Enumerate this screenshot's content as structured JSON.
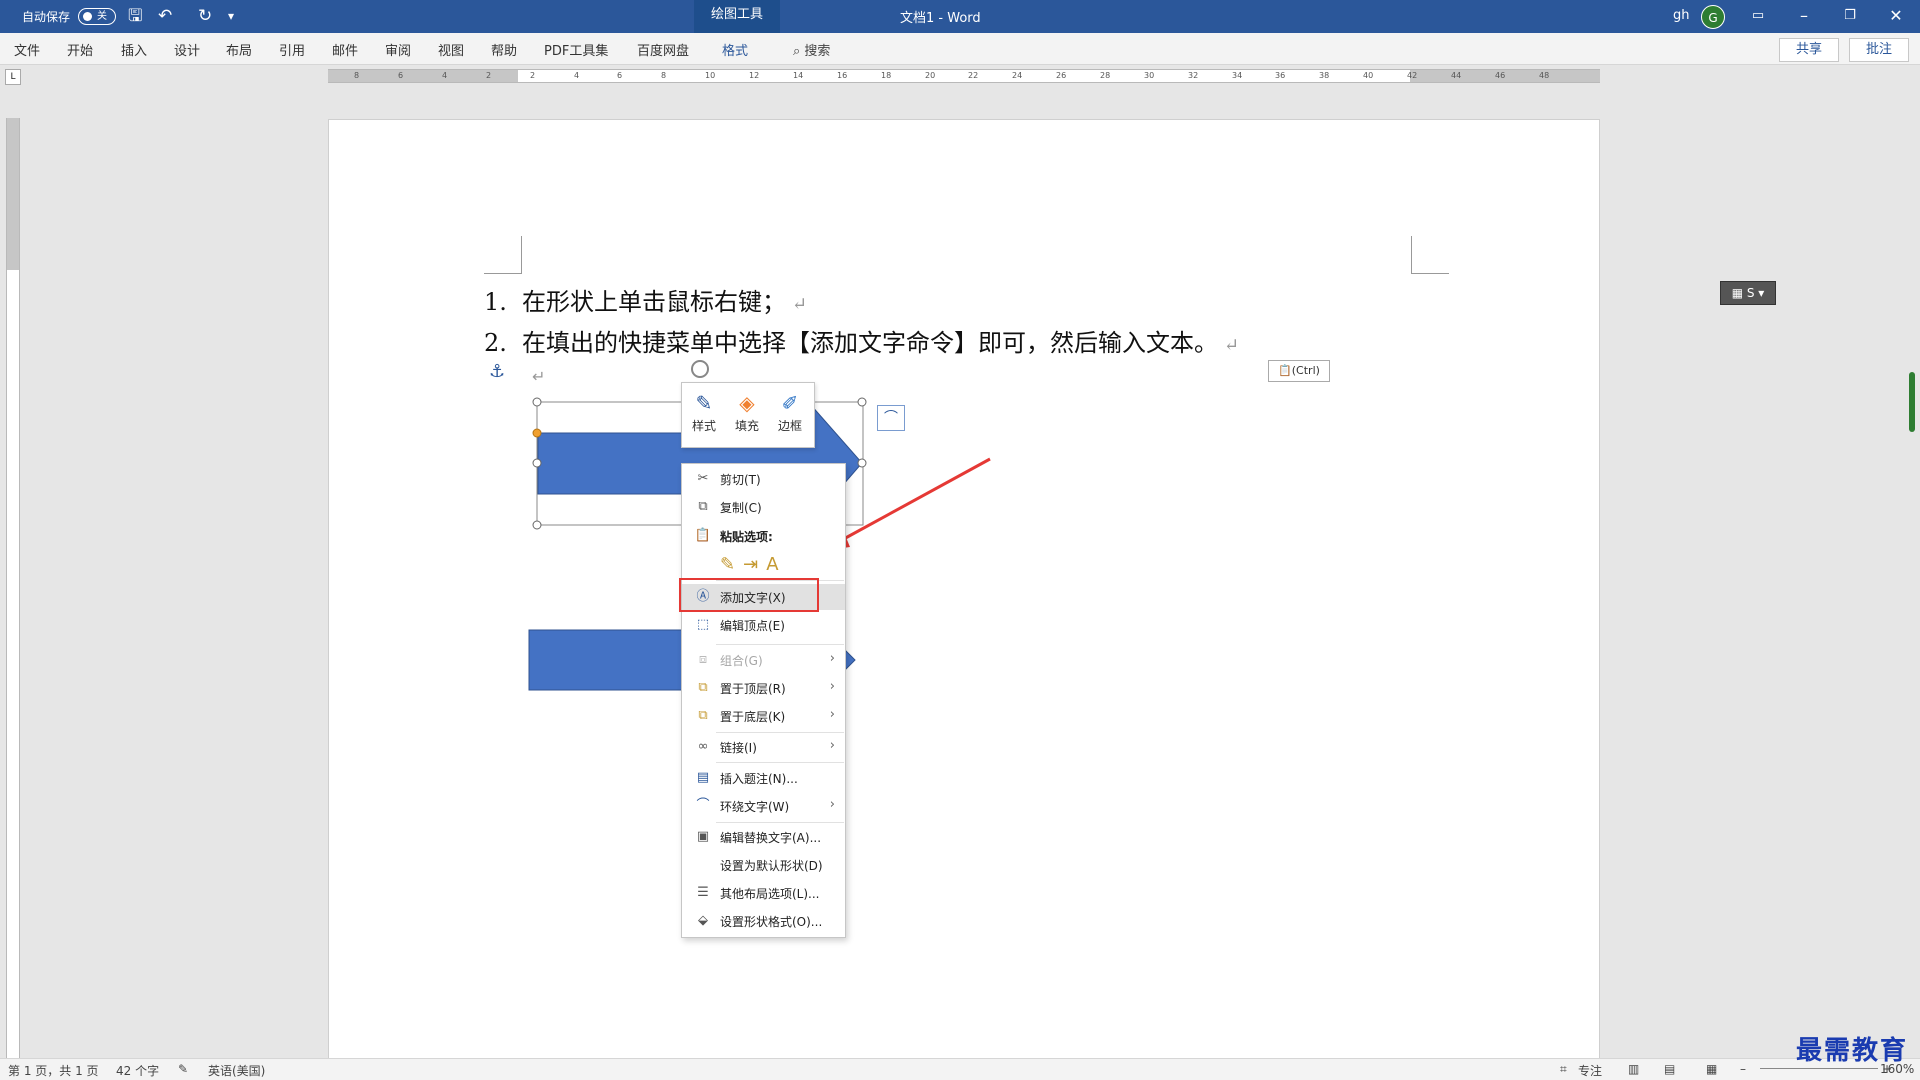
{
  "titlebar": {
    "autosave_label": "自动保存",
    "autosave_state": "关",
    "context_tab": "绘图工具",
    "doc_title": "文档1  -  Word",
    "user": "gh",
    "avatar_initial": "G"
  },
  "ribbon": {
    "tabs": [
      "文件",
      "开始",
      "插入",
      "设计",
      "布局",
      "引用",
      "邮件",
      "审阅",
      "视图",
      "帮助",
      "PDF工具集",
      "百度网盘",
      "格式"
    ],
    "search": "搜索",
    "share": "共享",
    "comment": "批注"
  },
  "ruler": {
    "ticks": [
      "8",
      "6",
      "4",
      "2",
      "2",
      "4",
      "6",
      "8",
      "10",
      "12",
      "14",
      "16",
      "18",
      "20",
      "22",
      "24",
      "26",
      "28",
      "30",
      "32",
      "34",
      "36",
      "38",
      "40",
      "42",
      "44",
      "46",
      "48"
    ]
  },
  "document": {
    "items": [
      {
        "num": "1.",
        "text": "在形状上单击鼠标右键；"
      },
      {
        "num": "2.",
        "text": "在填出的快捷菜单中选择【添加文字命令】即可，然后输入文本。"
      }
    ],
    "paste_ctrl": "(Ctrl)"
  },
  "mini_toolbar": [
    {
      "label": "样式",
      "icon": "shape-style-icon"
    },
    {
      "label": "填充",
      "icon": "fill-bucket-icon"
    },
    {
      "label": "边框",
      "icon": "outline-pen-icon"
    }
  ],
  "context_menu": {
    "cut": "剪切(T)",
    "copy": "复制(C)",
    "paste_options": "粘贴选项:",
    "add_text": "添加文字(X)",
    "edit_points": "编辑顶点(E)",
    "group": "组合(G)",
    "bring_front": "置于顶层(R)",
    "send_back": "置于底层(K)",
    "link": "链接(I)",
    "insert_caption": "插入题注(N)...",
    "wrap_text": "环绕文字(W)",
    "edit_alt_text": "编辑替换文字(A)...",
    "set_default": "设置为默认形状(D)",
    "more_layout": "其他布局选项(L)...",
    "format_shape": "设置形状格式(O)..."
  },
  "statusbar": {
    "page": "第 1 页，共 1 页",
    "words": "42 个字",
    "language": "英语(美国)",
    "focus": "专注",
    "zoom": "160%"
  },
  "watermark": "最需教育",
  "colors": {
    "title_bar": "#2b579a",
    "shape_fill": "#4472c4",
    "highlight": "#e53935"
  }
}
